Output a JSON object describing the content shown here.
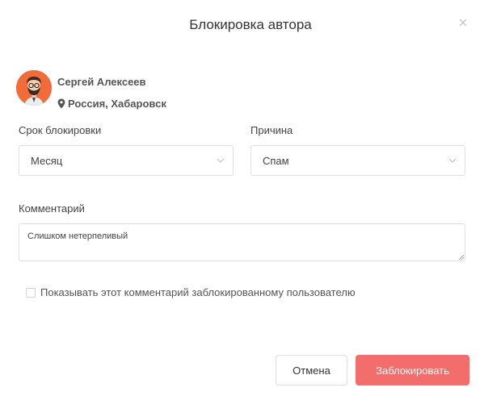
{
  "dialog": {
    "title": "Блокировка автора",
    "close_icon": "close-icon"
  },
  "author": {
    "name": "Сергей Алексеев",
    "location": "Россия, Хабаровск",
    "avatar_icon": "bearded-man-avatar",
    "location_icon": "map-pin-icon"
  },
  "form": {
    "duration": {
      "label": "Срок блокировки",
      "value": "Месяц"
    },
    "reason": {
      "label": "Причина",
      "value": "Спам"
    },
    "comment": {
      "label": "Комментарий",
      "value": "Слишком нетерпеливый"
    },
    "show_comment": {
      "label": "Показывать этот комментарий заблокированному пользователю",
      "checked": false
    }
  },
  "actions": {
    "cancel_label": "Отмена",
    "block_label": "Заблокировать"
  },
  "colors": {
    "primary_button": "#f36d6d",
    "avatar_bg": "#f26c3a",
    "border": "#dcdfe6"
  }
}
